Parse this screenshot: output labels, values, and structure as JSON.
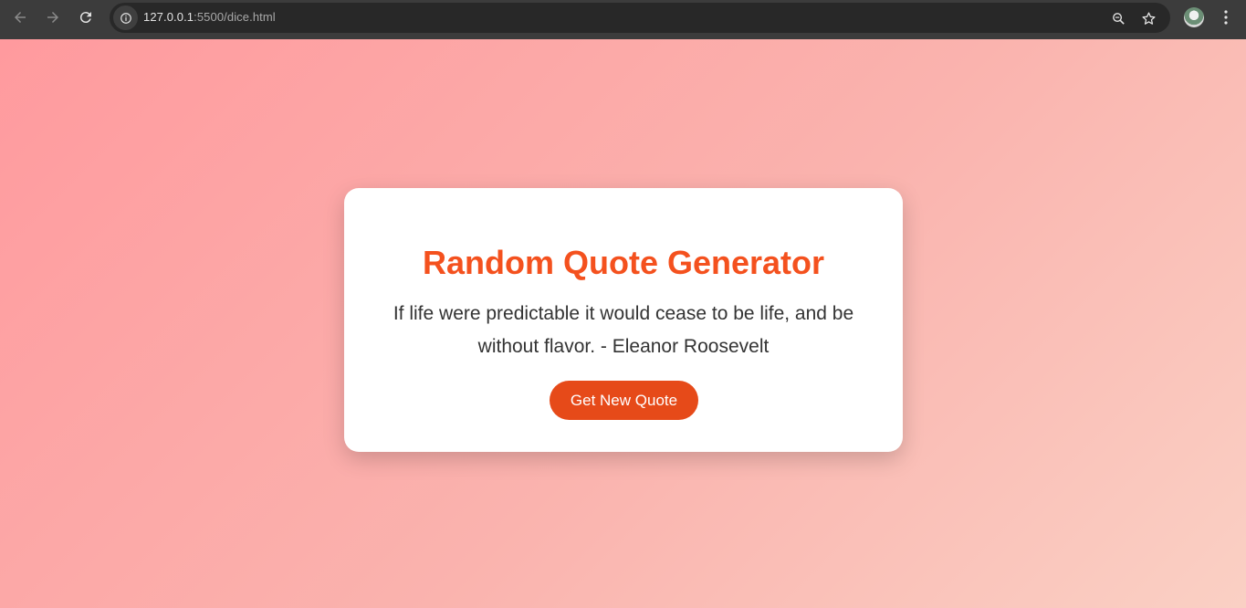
{
  "browser": {
    "url_host": "127.0.0.1",
    "url_path": ":5500/dice.html",
    "icons": [
      "back-icon",
      "forward-icon",
      "reload-icon",
      "site-info-icon",
      "zoom-icon",
      "bookmark-star-icon",
      "profile-avatar",
      "kebab-menu-icon"
    ]
  },
  "page": {
    "title": "Random Quote Generator",
    "quote": "If life were predictable it would cease to be life, and be without flavor. - Eleanor Roosevelt",
    "button_label": "Get New Quote"
  },
  "colors": {
    "title": "#f4511e",
    "button": "#e64a19",
    "background_start": "#ff9a9e",
    "background_end": "#fad0c4"
  }
}
